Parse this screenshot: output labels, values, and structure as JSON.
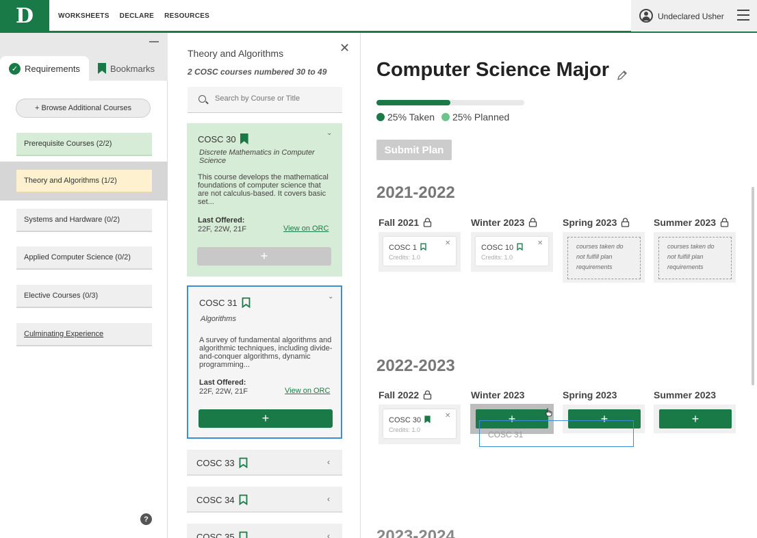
{
  "topbar": {
    "logo": "D",
    "nav": [
      "WORKSHEETS",
      "DECLARE",
      "RESOURCES"
    ],
    "user_name": "Undeclared Usher"
  },
  "left": {
    "tabs": {
      "requirements": "Requirements",
      "bookmarks": "Bookmarks"
    },
    "browse_label": "+ Browse Additional Courses",
    "items": [
      {
        "label": "Prerequisite Courses (2/2)"
      },
      {
        "label": "Theory and Algorithms (1/2)"
      },
      {
        "label": "Systems and Hardware (0/2)"
      },
      {
        "label": "Applied Computer Science (0/2)"
      },
      {
        "label": "Elective Courses (0/3)"
      },
      {
        "label": "Culminating Experience"
      }
    ],
    "help": "?"
  },
  "panel": {
    "title": "Theory and Algorithms",
    "subtitle": "2 COSC courses numbered 30 to 49",
    "search_placeholder": "Search by Course or Title",
    "cards": [
      {
        "code": "COSC 30",
        "name": "Discrete Mathematics in Computer Science",
        "desc": "This course develops the mathematical foundations of computer science that are not calculus-based. It covers basic set...",
        "last_offered_label": "Last Offered:",
        "last_offered": "22F, 22W, 21F",
        "orc": "View on ORC",
        "add": "+"
      },
      {
        "code": "COSC 31",
        "name": "Algorithms",
        "desc": "A survey of fundamental algorithms and algorithmic techniques, including divide-and-conquer algorithms, dynamic programming...",
        "last_offered_label": "Last Offered:",
        "last_offered": "22F, 22W, 21F",
        "orc": "View on ORC",
        "add": "+"
      }
    ],
    "collapsed": [
      "COSC 33",
      "COSC 34",
      "COSC 35"
    ]
  },
  "plan": {
    "title": "Computer Science Major",
    "progress": {
      "taken_fraction": 0.25,
      "planned_fraction": 0.25
    },
    "legend": {
      "taken": "25% Taken",
      "planned": "25% Planned"
    },
    "submit": "Submit Plan",
    "years": [
      {
        "label": "2021-2022",
        "terms": [
          "Fall 2021",
          "Winter 2023",
          "Spring 2023",
          "Summer 2023"
        ],
        "courses": [
          {
            "code": "COSC 1",
            "credits": "Credits: 1.0"
          },
          {
            "code": "COSC 10",
            "credits": "Credits: 1.0"
          }
        ],
        "empty_note": "courses taken do not fulfill plan requirements"
      },
      {
        "label": "2022-2023",
        "terms": [
          "Fall 2022",
          "Winter 2023",
          "Spring 2023",
          "Summer 2023"
        ],
        "courses": [
          {
            "code": "COSC 30",
            "credits": "Credits: 1.0"
          }
        ]
      }
    ],
    "drag_label": "COSC 31",
    "next_year": "2023-2024"
  },
  "colors": {
    "brand": "#1a7a47",
    "planned": "#6cc48a",
    "selection": "#3a8ed8"
  }
}
